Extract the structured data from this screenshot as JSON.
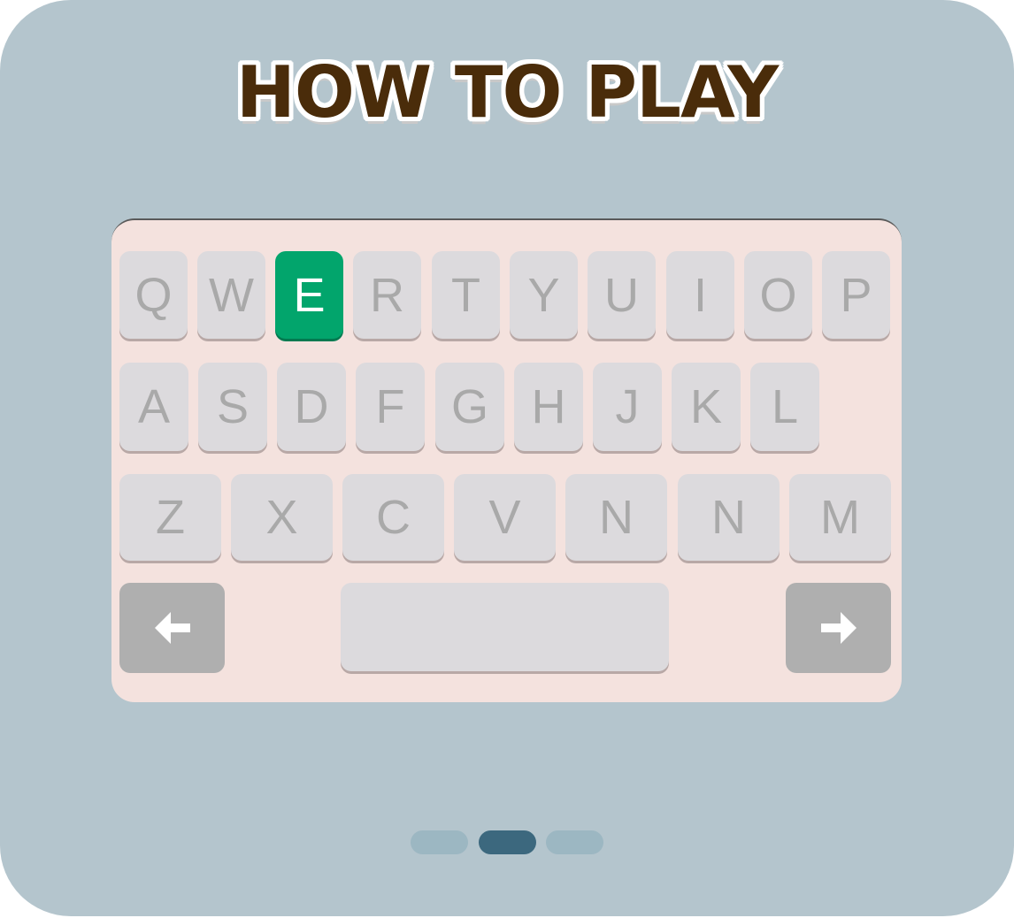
{
  "title": "HOW TO PLAY",
  "keyboard": {
    "rows": [
      [
        "Q",
        "W",
        "E",
        "R",
        "T",
        "Y",
        "U",
        "I",
        "O",
        "P"
      ],
      [
        "A",
        "S",
        "D",
        "F",
        "G",
        "H",
        "J",
        "K",
        "L"
      ],
      [
        "Z",
        "X",
        "C",
        "V",
        "N",
        "N",
        "M"
      ]
    ],
    "highlighted_key": "E",
    "back_key_icon": "arrow-left-icon",
    "forward_key_icon": "arrow-right-icon"
  },
  "pagination": {
    "page_count": 3,
    "current_page": 2
  },
  "colors": {
    "background": "#b4c5cd",
    "keyboard_bg": "#f4e2de",
    "key_bg": "#dcdadd",
    "key_text": "#a9a9a9",
    "highlight": "#02a56c",
    "nav_key": "#afafaf",
    "title_text": "#4a2c0a",
    "dot_active": "#3c687e",
    "dot_inactive": "#9cb7c2"
  }
}
